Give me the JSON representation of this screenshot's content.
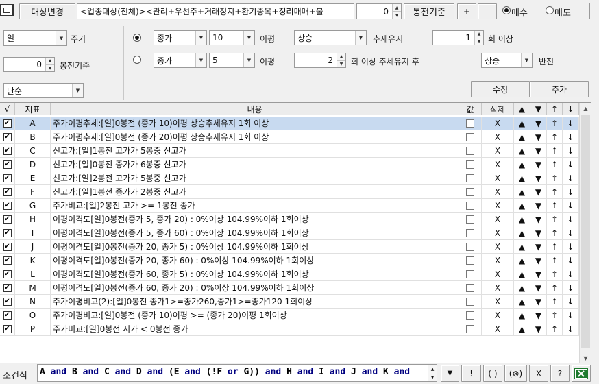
{
  "toolbar": {
    "target_change": "대상변경",
    "target_text": "<업종대상(전체)><관리+우선주+거래정지+환기종목+정리매매+불",
    "bong_value": "0",
    "bong_label": "봉전기준",
    "plus": "+",
    "minus": "-",
    "buy": "매수",
    "sell": "매도",
    "buy_selected": true
  },
  "left": {
    "period_value": "일",
    "period_label": "주기",
    "bong_value": "0",
    "bong_label": "봉전기준",
    "mode_value": "단순"
  },
  "cond1": {
    "field": "종가",
    "period": "10",
    "unit": "이평",
    "trend": "상승",
    "trend_label": "추세유지",
    "count": "1",
    "count_label": "회 이상",
    "selected": true
  },
  "cond2": {
    "field": "종가",
    "period": "5",
    "unit": "이평",
    "count": "2",
    "count_label": "회 이상 추세유지 후",
    "trend": "상승",
    "trend_label": "반전",
    "selected": false
  },
  "actions": {
    "modify": "수정",
    "add": "추가"
  },
  "grid": {
    "headers": {
      "check": "√",
      "id": "지표",
      "content": "내용",
      "value": "값",
      "delete": "삭제",
      "up_top": "▲",
      "down_bottom": "▼",
      "up": "↑",
      "down": "↓"
    },
    "rows": [
      {
        "id": "A",
        "content": "주가이평추세:[일]0봉전 (종가 10)이평 상승추세유지 1회 이상"
      },
      {
        "id": "B",
        "content": "주가이평추세:[일]0봉전 (종가 20)이평 상승추세유지 1회 이상"
      },
      {
        "id": "C",
        "content": "신고가:[일]1봉전 고가가 5봉중 신고가"
      },
      {
        "id": "D",
        "content": "신고가:[일]0봉전 종가가 6봉중 신고가"
      },
      {
        "id": "E",
        "content": "신고가:[일]2봉전 고가가 5봉중 신고가"
      },
      {
        "id": "F",
        "content": "신고가:[일]1봉전 종가가 2봉중 신고가"
      },
      {
        "id": "G",
        "content": "주가비교:[일]2봉전 고가 >= 1봉전 종가"
      },
      {
        "id": "H",
        "content": "이평이격도[일]0봉전(종가 5, 종가 20) : 0%이상 104.99%이하 1회이상"
      },
      {
        "id": "I",
        "content": "이평이격도[일]0봉전(종가 5, 종가 60) : 0%이상 104.99%이하 1회이상"
      },
      {
        "id": "J",
        "content": "이평이격도[일]0봉전(종가 20, 종가 5) : 0%이상 104.99%이하 1회이상"
      },
      {
        "id": "K",
        "content": "이평이격도[일]0봉전(종가 20, 종가 60) : 0%이상 104.99%이하 1회이상"
      },
      {
        "id": "L",
        "content": "이평이격도[일]0봉전(종가 60, 종가 5) : 0%이상 104.99%이하 1회이상"
      },
      {
        "id": "M",
        "content": "이평이격도[일]0봉전(종가 60, 종가 20) : 0%이상 104.99%이하 1회이상"
      },
      {
        "id": "N",
        "content": "주가이평비교(2):[일]0봉전 종가1>=종가260,종가1>=종가120 1회이상"
      },
      {
        "id": "O",
        "content": "주가이평비교:[일]0봉전 (종가 10)이평 >= (종가 20)이평 1회이상"
      },
      {
        "id": "P",
        "content": "주가비교:[일]0봉전 시가 < 0봉전 종가"
      }
    ],
    "check_mark": "✔",
    "delete_mark": "X",
    "selected_row": 0
  },
  "footer": {
    "label": "조건식",
    "formula_tokens": [
      "A",
      "and",
      "B",
      "and",
      "C",
      "and",
      "D",
      "and",
      "(E",
      "and",
      "(!F",
      "or",
      "G))",
      "and",
      "H",
      "and",
      "I",
      "and",
      "J",
      "and",
      "K",
      "and"
    ],
    "btn_down": "▼",
    "btn_not": "!",
    "btn_paren": "( )",
    "btn_xor": "(⊗)",
    "btn_x": "X",
    "btn_help": "?",
    "excel_color": "#1e7a2e"
  },
  "colors": {
    "selected_row": "#c8daf0",
    "formula_keyword": "#000080"
  }
}
